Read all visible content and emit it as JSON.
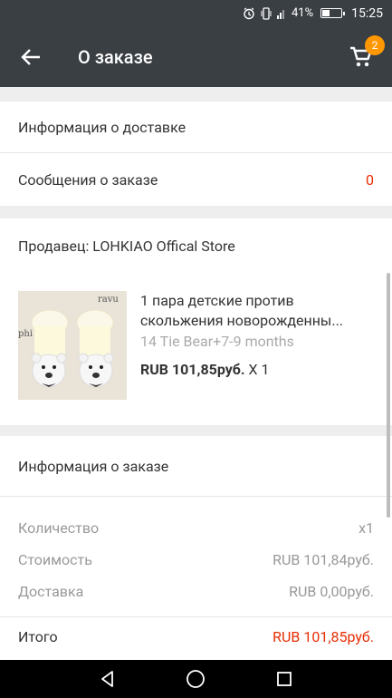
{
  "status_bar": {
    "battery": "41%",
    "time": "15:25",
    "battery_level": 0.41
  },
  "app_bar": {
    "title": "О заказе",
    "cart_count": "2"
  },
  "delivery_info_label": "Информация о доставке",
  "messages": {
    "label": "Сообщения о заказе",
    "count": "0"
  },
  "seller_label": "Продавец: LOHKIAO Offical Store",
  "product": {
    "title_line1": "1 пара детские против",
    "title_line2": "скольжения новорожденны...",
    "variant": "14 Tie Bear+7-9 months",
    "price": "RUB 101,85руб.",
    "qty": " X 1",
    "image_text": "ravu",
    "image_text2": "phi"
  },
  "order_info": {
    "heading": "Информация о заказе",
    "rows": [
      {
        "label": "Количество",
        "value": "x1"
      },
      {
        "label": "Стоимость",
        "value": "RUB 101,84руб."
      },
      {
        "label": "Доставка",
        "value": "RUB 0,00руб."
      }
    ],
    "total_label": "Итого",
    "total_value": "RUB 101,85руб."
  },
  "colors": {
    "header": "#3a3f44",
    "accent_red": "#e62e04",
    "badge": "#ff9800"
  }
}
